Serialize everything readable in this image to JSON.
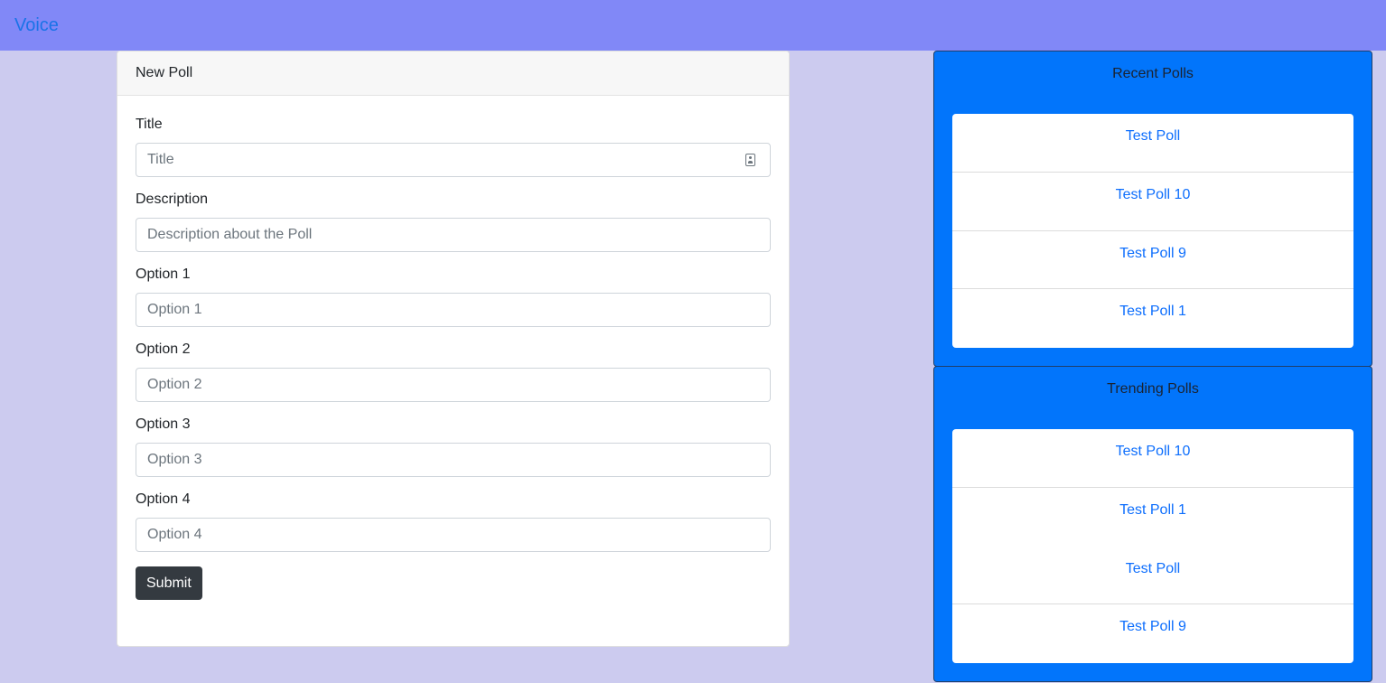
{
  "navbar": {
    "brand": "Voice"
  },
  "form": {
    "header": "New Poll",
    "fields": [
      {
        "label": "Title",
        "placeholder": "Title"
      },
      {
        "label": "Description",
        "placeholder": "Description about the Poll"
      },
      {
        "label": "Option 1",
        "placeholder": "Option 1"
      },
      {
        "label": "Option 2",
        "placeholder": "Option 2"
      },
      {
        "label": "Option 3",
        "placeholder": "Option 3"
      },
      {
        "label": "Option 4",
        "placeholder": "Option 4"
      }
    ],
    "submit_label": "Submit"
  },
  "recent": {
    "title": "Recent Polls",
    "items": [
      "Test Poll",
      "Test Poll 10",
      "Test Poll 9",
      "Test Poll 1"
    ]
  },
  "trending": {
    "title": "Trending Polls",
    "items": [
      "Test Poll 10",
      "Test Poll 1",
      "Test Poll",
      "Test Poll 9"
    ]
  },
  "colors": {
    "background": "#cccbef",
    "navbar": "#8188f7",
    "side_panel": "#0275fb",
    "link": "#0d6efd",
    "submit": "#343a40"
  }
}
